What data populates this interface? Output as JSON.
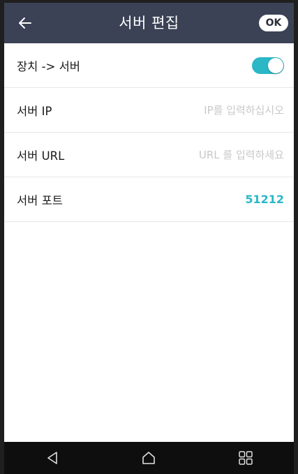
{
  "header": {
    "title": "서버 편집",
    "ok_label": "OK",
    "back_icon": "arrow-left-icon"
  },
  "settings": {
    "rows": [
      {
        "label": "장치 -> 서버",
        "type": "toggle",
        "toggle_on": true
      },
      {
        "label": "서버 IP",
        "type": "input",
        "value": "",
        "placeholder": "IP를 입력하십시오"
      },
      {
        "label": "서버 URL",
        "type": "input",
        "value": "",
        "placeholder": "URL 를 입력하세요"
      },
      {
        "label": "서버 포트",
        "type": "value",
        "value": "51212"
      }
    ]
  },
  "navbar": {
    "icons": [
      "back-triangle-icon",
      "home-icon",
      "recent-apps-icon"
    ]
  },
  "colors": {
    "appbar": "#3b4256",
    "accent": "#2bb7c6",
    "placeholder": "#c8c8c8",
    "navbar": "#0e0e0e"
  }
}
